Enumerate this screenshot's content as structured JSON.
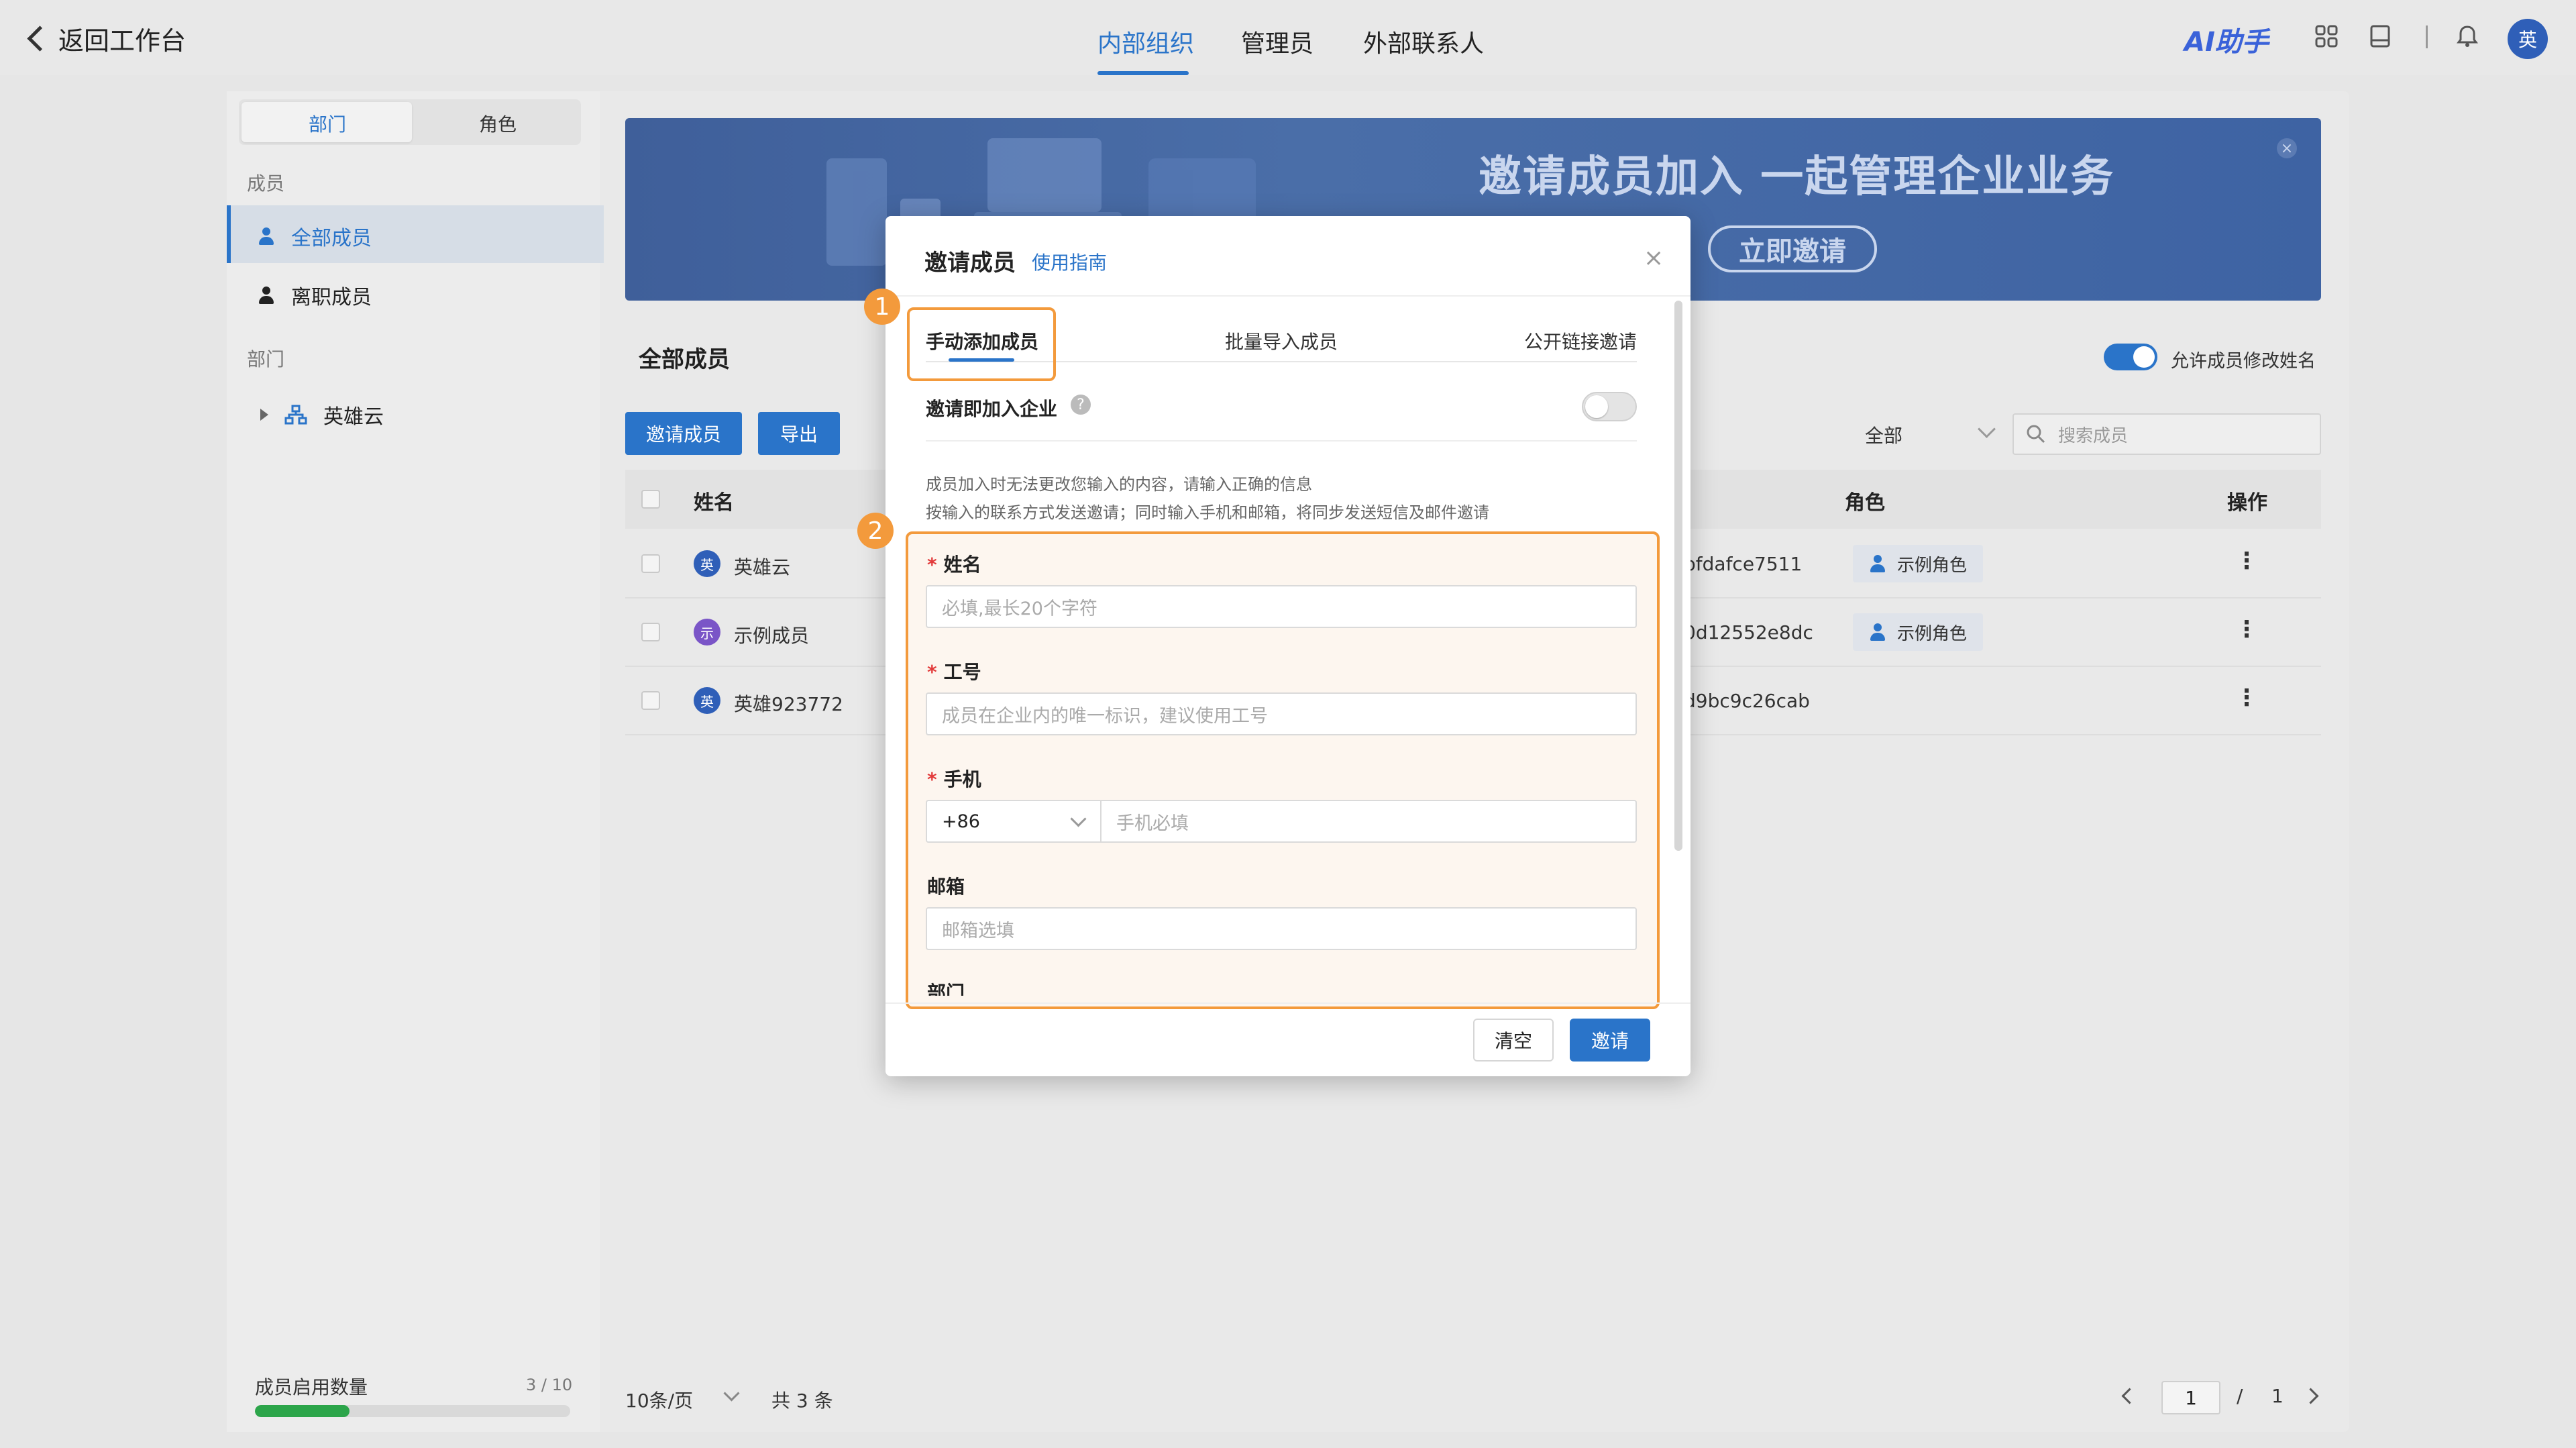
{
  "header": {
    "back_label": "返回工作台",
    "tabs": [
      {
        "label": "内部组织",
        "active": true
      },
      {
        "label": "管理员",
        "active": false
      },
      {
        "label": "外部联系人",
        "active": false
      }
    ],
    "ai_label": "AI助手",
    "avatar_text": "英"
  },
  "sidebar": {
    "segments": [
      "部门",
      "角色"
    ],
    "members_section": "成员",
    "items": [
      "全部成员",
      "离职成员"
    ],
    "dept_section": "部门",
    "tree_root": "英雄云",
    "usage_label": "成员启用数量",
    "usage_count": "3 / 10",
    "usage_fraction": 0.3
  },
  "banner": {
    "title": "邀请成员加入 一起管理企业业务",
    "button": "立即邀请",
    "close": "×"
  },
  "main": {
    "title": "全部成员",
    "allow_rename_label": "允许成员修改姓名",
    "buttons": {
      "invite": "邀请成员",
      "export": "导出"
    },
    "filter_value": "全部",
    "search_placeholder": "搜索成员",
    "columns": {
      "name": "姓名",
      "role": "角色",
      "actions": "操作"
    },
    "rows": [
      {
        "avatar": "英",
        "avatar_color": "#2f5fb8",
        "name": "英雄云",
        "id": "bfdafce7511",
        "role": "示例角色"
      },
      {
        "avatar": "示",
        "avatar_color": "#7a55c7",
        "name": "示例成员",
        "id": "0d12552e8dc",
        "role": "示例角色"
      },
      {
        "avatar": "英",
        "avatar_color": "#2f5fb8",
        "name": "英雄923772",
        "id": "d9bc9c26cab",
        "role": ""
      }
    ],
    "pagination": {
      "per_page": "10条/页",
      "total": "共 3 条",
      "current": "1",
      "sep": "/",
      "pages": "1"
    }
  },
  "modal": {
    "title": "邀请成员",
    "guide": "使用指南",
    "close": "×",
    "tabs": [
      "手动添加成员",
      "批量导入成员",
      "公开链接邀请"
    ],
    "join_toggle_label": "邀请即加入企业",
    "hint_line1": "成员加入时无法更改您输入的内容，请输入正确的信息",
    "hint_line2": "按输入的联系方式发送邀请；同时输入手机和邮箱，将同步发送短信及邮件邀请",
    "fields": {
      "name_label": "姓名",
      "name_placeholder": "必填,最长20个字符",
      "jobno_label": "工号",
      "jobno_placeholder": "成员在企业内的唯一标识，建议使用工号",
      "phone_label": "手机",
      "phone_code": "+86",
      "phone_placeholder": "手机必填",
      "email_label": "邮箱",
      "email_placeholder": "邮箱选填",
      "dept_label": "部门"
    },
    "required_mark": "*",
    "buttons": {
      "clear": "清空",
      "invite": "邀请"
    },
    "callouts": [
      "1",
      "2"
    ]
  },
  "colors": {
    "accent": "#2a74c9",
    "highlight": "#f39a3c",
    "progress": "#2ca54a"
  }
}
